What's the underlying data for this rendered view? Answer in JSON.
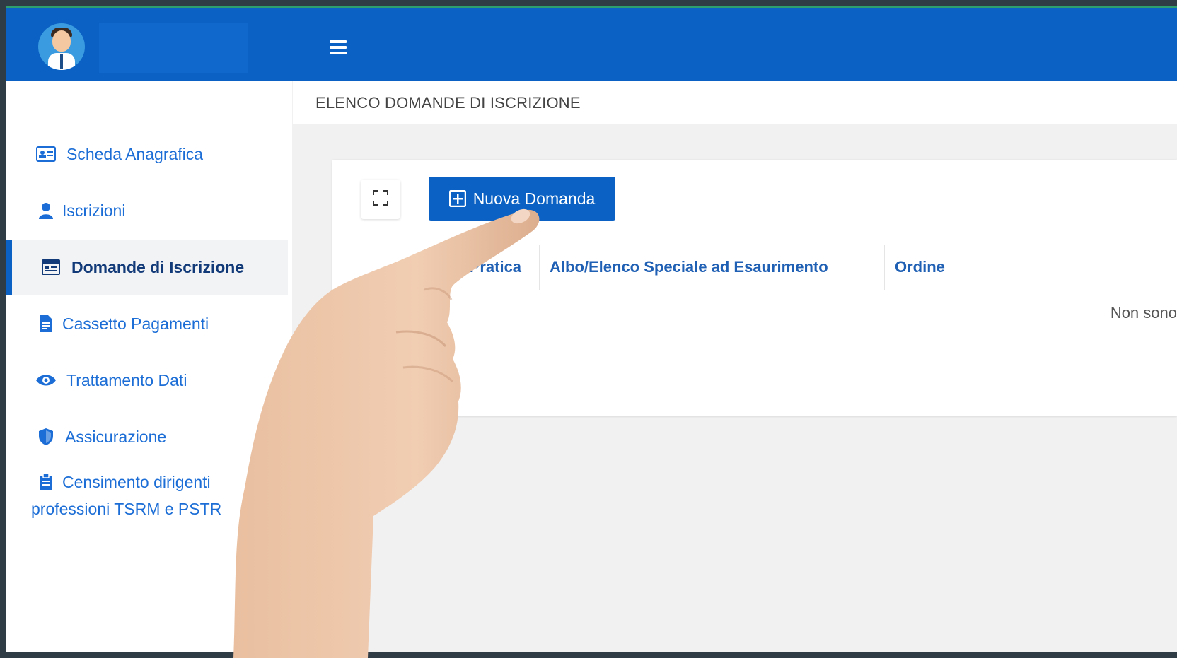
{
  "sidebar": {
    "items": [
      {
        "label": "Scheda Anagrafica",
        "icon": "id-card-icon"
      },
      {
        "label": "Iscrizioni",
        "icon": "user-icon"
      },
      {
        "label": "Domande di Iscrizione",
        "icon": "form-icon",
        "active": true
      },
      {
        "label": "Cassetto Pagamenti",
        "icon": "document-icon"
      },
      {
        "label": "Trattamento Dati",
        "icon": "eye-icon"
      },
      {
        "label": "Assicurazione",
        "icon": "shield-icon"
      },
      {
        "label_line1": "Censimento dirigenti",
        "label_line2": "professioni TSRM e PSTR",
        "icon": "clipboard-icon"
      }
    ]
  },
  "header": {
    "title": "ELENCO DOMANDE DI ISCRIZIONE"
  },
  "card": {
    "new_button": "Nuova Domanda",
    "columns": [
      "n. Pratica",
      "Albo/Elenco Speciale ad Esaurimento",
      "Ordine"
    ],
    "empty_message": "Non sono"
  },
  "colors": {
    "primary": "#0b62c4",
    "link": "#1c6ed6",
    "active_text": "#123a78"
  }
}
